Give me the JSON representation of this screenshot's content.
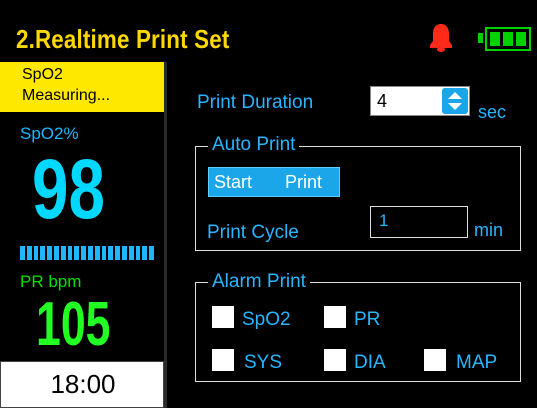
{
  "header": {
    "title": "2.Realtime Print Set",
    "alarm_icon": "bell-icon",
    "battery_icon": "battery-icon",
    "battery_cells": 3
  },
  "left_panel": {
    "status_line1": "SpO2",
    "status_line2": "Measuring...",
    "spo2_label": "SpO2%",
    "spo2_value": "98",
    "pulse_bar_segments": 20,
    "pr_label": "PR bpm",
    "pr_value": "105",
    "time": "18:00"
  },
  "settings": {
    "print_duration_label": "Print Duration",
    "print_duration_value": "4",
    "print_duration_unit": "sec",
    "auto_print": {
      "legend": "Auto Print",
      "start_label_1": "Start",
      "start_label_2": "Print",
      "cycle_label": "Print Cycle",
      "cycle_value": "1",
      "cycle_unit": "min"
    },
    "alarm_print": {
      "legend": "Alarm Print",
      "options": [
        {
          "label": "SpO2",
          "checked": false
        },
        {
          "label": "PR",
          "checked": false
        },
        {
          "label": "SYS",
          "checked": false
        },
        {
          "label": "DIA",
          "checked": false
        },
        {
          "label": "MAP",
          "checked": false
        }
      ]
    }
  },
  "colors": {
    "title": "#ffd800",
    "accent": "#27b6ff",
    "spo2": "#00d8ff",
    "pr": "#22ff22",
    "status_bg": "#ffe800",
    "alarm": "#ff2a1a",
    "battery": "#00d200"
  }
}
